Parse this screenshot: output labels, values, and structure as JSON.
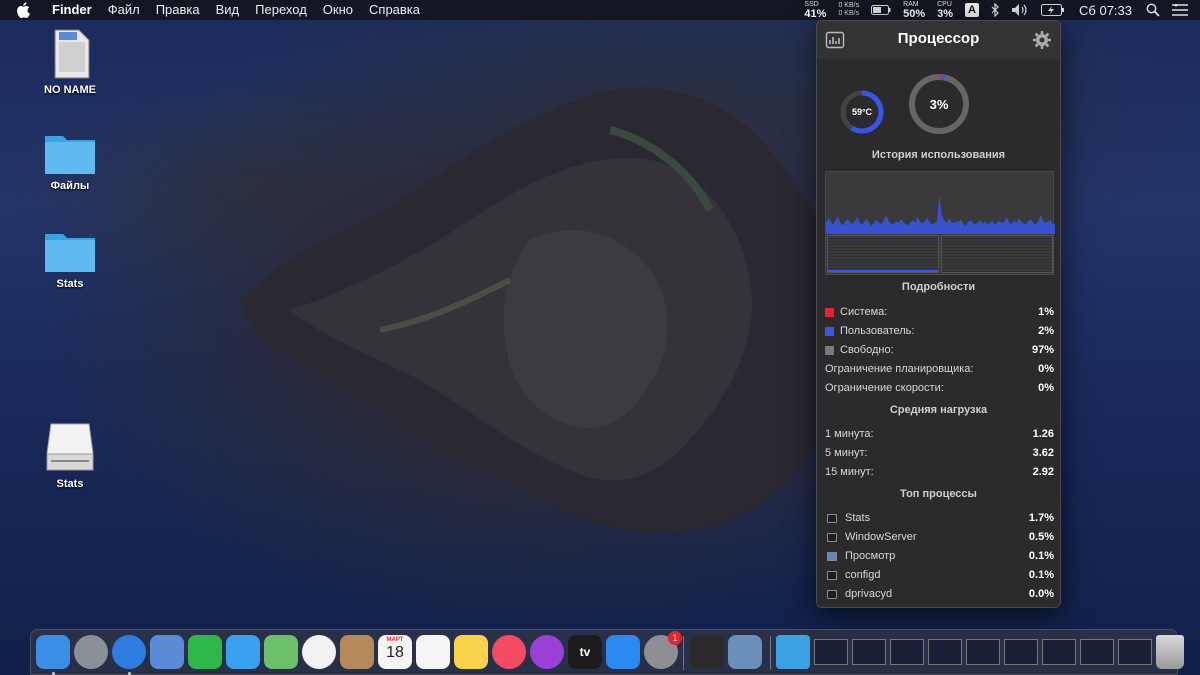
{
  "menubar": {
    "app_name": "Finder",
    "menus": [
      "Файл",
      "Правка",
      "Вид",
      "Переход",
      "Окно",
      "Справка"
    ],
    "ssd": {
      "label": "SSD",
      "value": "41%"
    },
    "net": {
      "up": "0 KB/s",
      "down": "0 KB/s"
    },
    "ram": {
      "label": "RAM",
      "value": "50%"
    },
    "cpu": {
      "label": "CPU",
      "value": "3%"
    },
    "input_source": "A",
    "clock": "Сб 07:33"
  },
  "desktop": {
    "icons": [
      {
        "label": "NO NAME",
        "kind": "sd-card"
      },
      {
        "label": "Файлы",
        "kind": "folder"
      },
      {
        "label": "Stats",
        "kind": "folder"
      },
      {
        "label": "Stats",
        "kind": "disk"
      }
    ]
  },
  "popup": {
    "title": "Процессор",
    "temperature": "59°C",
    "temperature_level": 0.59,
    "usage": "3%",
    "usage_level": 0.03,
    "history_title": "История использования",
    "details_title": "Подробности",
    "details": [
      {
        "label": "Система:",
        "value": "1%",
        "color": "#e8232f"
      },
      {
        "label": "Пользователь:",
        "value": "2%",
        "color": "#3a56e8"
      },
      {
        "label": "Свободно:",
        "value": "97%",
        "color": "#7a7a7a"
      },
      {
        "label": "Ограничение планировщика:",
        "value": "0%"
      },
      {
        "label": "Ограничение скорости:",
        "value": "0%"
      }
    ],
    "load_title": "Средняя нагрузка",
    "load": [
      {
        "label": "1 минута:",
        "value": "1.26"
      },
      {
        "label": "5 минут:",
        "value": "3.62"
      },
      {
        "label": "15 минут:",
        "value": "2.92"
      }
    ],
    "top_title": "Топ процессы",
    "processes": [
      {
        "name": "Stats",
        "value": "1.7%"
      },
      {
        "name": "WindowServer",
        "value": "0.5%"
      },
      {
        "name": "Просмотр",
        "value": "0.1%"
      },
      {
        "name": "configd",
        "value": "0.1%"
      },
      {
        "name": "dprivacyd",
        "value": "0.0%"
      }
    ],
    "history_values": [
      0.18,
      0.26,
      0.2,
      0.15,
      0.22,
      0.28,
      0.17,
      0.14,
      0.2,
      0.24,
      0.19,
      0.16,
      0.21,
      0.27,
      0.18,
      0.15,
      0.2,
      0.25,
      0.17,
      0.13,
      0.19,
      0.23,
      0.18,
      0.16,
      0.22,
      0.3,
      0.2,
      0.17,
      0.15,
      0.21,
      0.18,
      0.24,
      0.2,
      0.16,
      0.14,
      0.19,
      0.22,
      0.18,
      0.28,
      0.2,
      0.17,
      0.21,
      0.26,
      0.19,
      0.15,
      0.18,
      0.2,
      0.63,
      0.3,
      0.22,
      0.18,
      0.25,
      0.2,
      0.17,
      0.21,
      0.19,
      0.24,
      0.16,
      0.14,
      0.2,
      0.22,
      0.18,
      0.15,
      0.19,
      0.23,
      0.17,
      0.2,
      0.16,
      0.18,
      0.22,
      0.15,
      0.19,
      0.21,
      0.18,
      0.2,
      0.27,
      0.19,
      0.16,
      0.22,
      0.18,
      0.25,
      0.2,
      0.17,
      0.15,
      0.21,
      0.24,
      0.18,
      0.16,
      0.2,
      0.3,
      0.22,
      0.18,
      0.2,
      0.23,
      0.17,
      0.15
    ]
  },
  "dock": {
    "apps": [
      {
        "name": "finder-icon",
        "color": "#3a8ee6",
        "running": true
      },
      {
        "name": "launchpad-icon",
        "color": "#8a8f98",
        "running": false
      },
      {
        "name": "safari-icon",
        "color": "#2f7de1",
        "running": true
      },
      {
        "name": "mail-icon",
        "color": "#5b8ad6",
        "running": false
      },
      {
        "name": "facetime-icon",
        "color": "#2fb84a",
        "running": false
      },
      {
        "name": "messages-icon",
        "color": "#3aa0f0",
        "running": false
      },
      {
        "name": "maps-icon",
        "color": "#6cc06a",
        "running": false
      },
      {
        "name": "photos-icon",
        "color": "#f2f2f2",
        "running": false
      },
      {
        "name": "contacts-icon",
        "color": "#b48a5a",
        "running": false
      },
      {
        "name": "calendar-icon",
        "color": "#f4f4f4",
        "running": false
      },
      {
        "name": "reminders-icon",
        "color": "#f5f5f5",
        "running": false
      },
      {
        "name": "notes-icon",
        "color": "#f7d24a",
        "running": false
      },
      {
        "name": "music-icon",
        "color": "#f54a63",
        "running": false
      },
      {
        "name": "podcasts-icon",
        "color": "#9b3fd6",
        "running": false
      },
      {
        "name": "tv-icon",
        "color": "#1c1c1e",
        "running": false
      },
      {
        "name": "app-store-icon",
        "color": "#2a8af0",
        "running": false
      },
      {
        "name": "system-preferences-icon",
        "color": "#8e8e93",
        "running": false
      },
      {
        "name": "terminal-icon",
        "color": "#2a2a2a",
        "running": false
      },
      {
        "name": "preview-icon",
        "color": "#6a8fb8",
        "running": false
      }
    ],
    "calendar_month": "МАРТ",
    "calendar_day": "18",
    "tv_label": "tv",
    "prefs_badge": "1",
    "thumbnails": 9
  }
}
